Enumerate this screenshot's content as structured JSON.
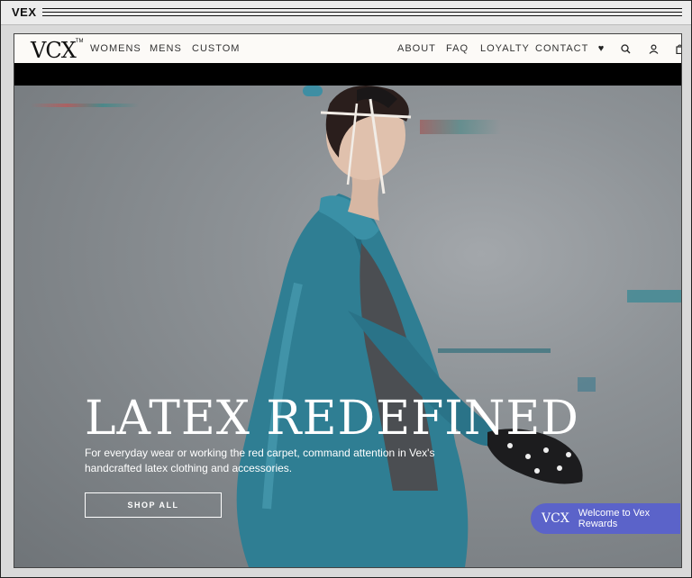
{
  "window": {
    "title": "VEX"
  },
  "nav": {
    "logo": "VCX",
    "logo_tm": "TM",
    "left_links": [
      "WOMENS",
      "MENS",
      "CUSTOM"
    ],
    "right_links": [
      "ABOUT",
      "FAQ",
      "LOYALTY",
      "CONTACT"
    ],
    "icons": {
      "wishlist": "♥",
      "search": "⌕",
      "account": "♙",
      "cart": "▢"
    }
  },
  "hero": {
    "headline": "LATEX REDEFINED",
    "subtext": "For everyday wear or working the red carpet, command attention in Vex's handcrafted latex clothing and accessories.",
    "cta": "SHOP ALL"
  },
  "rewards": {
    "logo": "VCX",
    "label": "Welcome to Vex Rewards"
  },
  "colors": {
    "nav_bg": "#fcfaf7",
    "hero_bg": "#8d9296",
    "rewards_bg": "#5b63c9",
    "garment": "#2f7e93"
  }
}
